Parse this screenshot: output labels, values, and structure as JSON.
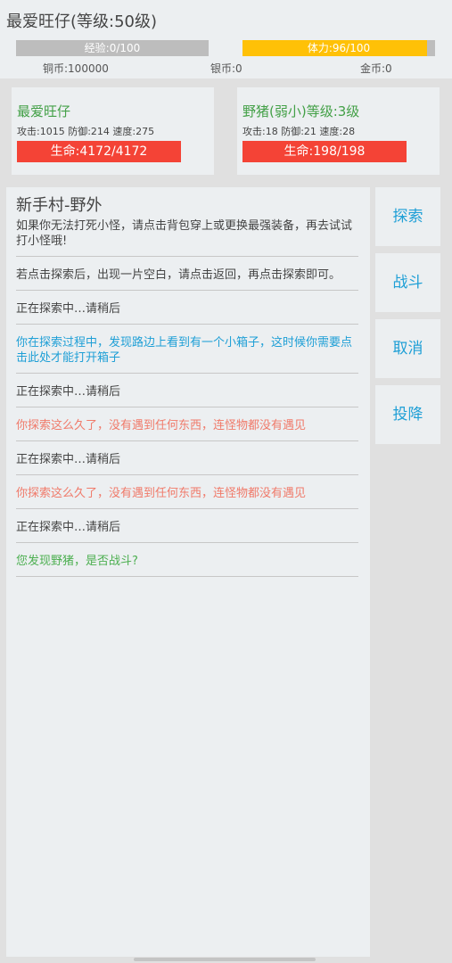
{
  "header": {
    "title": "最爱旺仔(等级:50级)",
    "exp_label": "经验:0/100",
    "exp_fraction": 0,
    "stamina_label": "体力:96/100",
    "stamina_fraction": 0.96,
    "copper": "铜币:100000",
    "silver": "银币:0",
    "gold": "金币:0"
  },
  "player": {
    "name": "最爱旺仔",
    "stats": "攻击:1015 防御:214 速度:275",
    "hp": "生命:4172/4172"
  },
  "enemy": {
    "name": "野猪(弱小)等级:3级",
    "stats": "攻击:18 防御:21 速度:28",
    "hp": "生命:198/198"
  },
  "log": {
    "location": "新手村-野外",
    "messages": [
      {
        "text": "如果你无法打死小怪，请点击背包穿上或更换最强装备，再去试试打小怪哦!",
        "tone": "default"
      },
      {
        "text": "若点击探索后，出现一片空白，请点击返回，再点击探索即可。",
        "tone": "default"
      },
      {
        "text": "正在探索中…请稍后",
        "tone": "default"
      },
      {
        "text": "你在探索过程中，发现路边上看到有一个小箱子，这时候你需要点击此处才能打开箱子",
        "tone": "blue"
      },
      {
        "text": "正在探索中…请稍后",
        "tone": "default"
      },
      {
        "text": "你探索这么久了，没有遇到任何东西，连怪物都没有遇见",
        "tone": "red"
      },
      {
        "text": "正在探索中…请稍后",
        "tone": "default"
      },
      {
        "text": "你探索这么久了，没有遇到任何东西，连怪物都没有遇见",
        "tone": "red"
      },
      {
        "text": "正在探索中…请稍后",
        "tone": "default"
      },
      {
        "text": "您发现野猪，是否战斗?",
        "tone": "green"
      }
    ]
  },
  "actions": {
    "explore": "探索",
    "fight": "战斗",
    "cancel": "取消",
    "surrender": "投降"
  },
  "colors": {
    "exp_bar": "#bdbdbd",
    "stamina_bar": "#ffc107",
    "hp_bar": "#f44336",
    "accent": "#1e9fd6",
    "name_green": "#43a047"
  }
}
